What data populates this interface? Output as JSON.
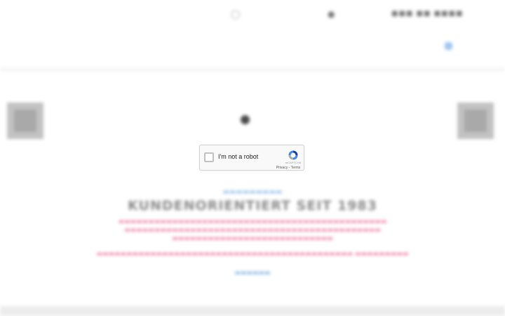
{
  "captcha": {
    "checkbox_label": "I'm not a robot",
    "brand": "reCAPTCHA",
    "privacy_link": "Privacy",
    "separator": " - ",
    "terms_link": "Terms"
  },
  "page": {
    "headline": "KUNDENORIENTIERT SEIT 1983"
  },
  "colors": {
    "accent_link": "#7fb1e3",
    "body_text": "#ef7fa6",
    "headline": "#8a8a8a"
  }
}
